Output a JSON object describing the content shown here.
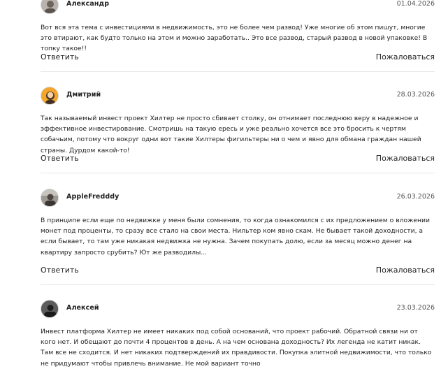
{
  "comments": [
    {
      "author": "Александр",
      "date": "01.04.2026",
      "text": "Вот вся эта тема с инвестициями в недвижимость, это не более чем развод! Уже многие об этом пишут, многие это втирают, как будто только на этом и можно заработать.. Это все развод, старый развод в новой упаковке! В топку такое!!",
      "reply_label": "Ответить",
      "report_label": "Пожаловаться"
    },
    {
      "author": "Дмитрий",
      "date": "28.03.2026",
      "text": "Так называемый инвест проект Хилтер не просто сбивает столку, он отнимает последнюю веру в надежное и эффективное инвестирование. Смотришь на такую ересь и уже реально хочется все это бросить к чертям собачьим, потому что вокруг одни вот такие Хилтеры фигильтеры ни о чем и явно для обмана граждан нашей страны. Дурдом какой-то!",
      "reply_label": "Ответить",
      "report_label": "Пожаловаться"
    },
    {
      "author": "AppleFredddy",
      "date": "26.03.2026",
      "text": "В принципе если еще по недвижке у меня были сомнения, то когда ознакомился с их предложением о вложении монет под проценты, то сразу все стало на свои места. Нильтер ком явно скам. Не бывает такой доходности, а если бывает, то там уже никакая недвижка не нужна. Зачем покупать долю, если за месяц можно денег на квартиру запросто срубить? Ют же разводилы...",
      "reply_label": "Ответить",
      "report_label": "Пожаловаться"
    },
    {
      "author": "Алексей",
      "date": "23.03.2026",
      "text": "Инвест платформа Хилтер не имеет никаких под собой оснований, что проект рабочий. Обратной связи ни от кого нет. И обещают до почти 4 процентов в день. А на чем основана доходность? Их легенда не катит никак. Там все не сходится. И нет никаких подтверждений их правдивости. Покупка элитной недвижимости, что только не придумают чтобы привлечь внимание. Не мой вариант точно",
      "reply_label": "",
      "report_label": ""
    }
  ]
}
